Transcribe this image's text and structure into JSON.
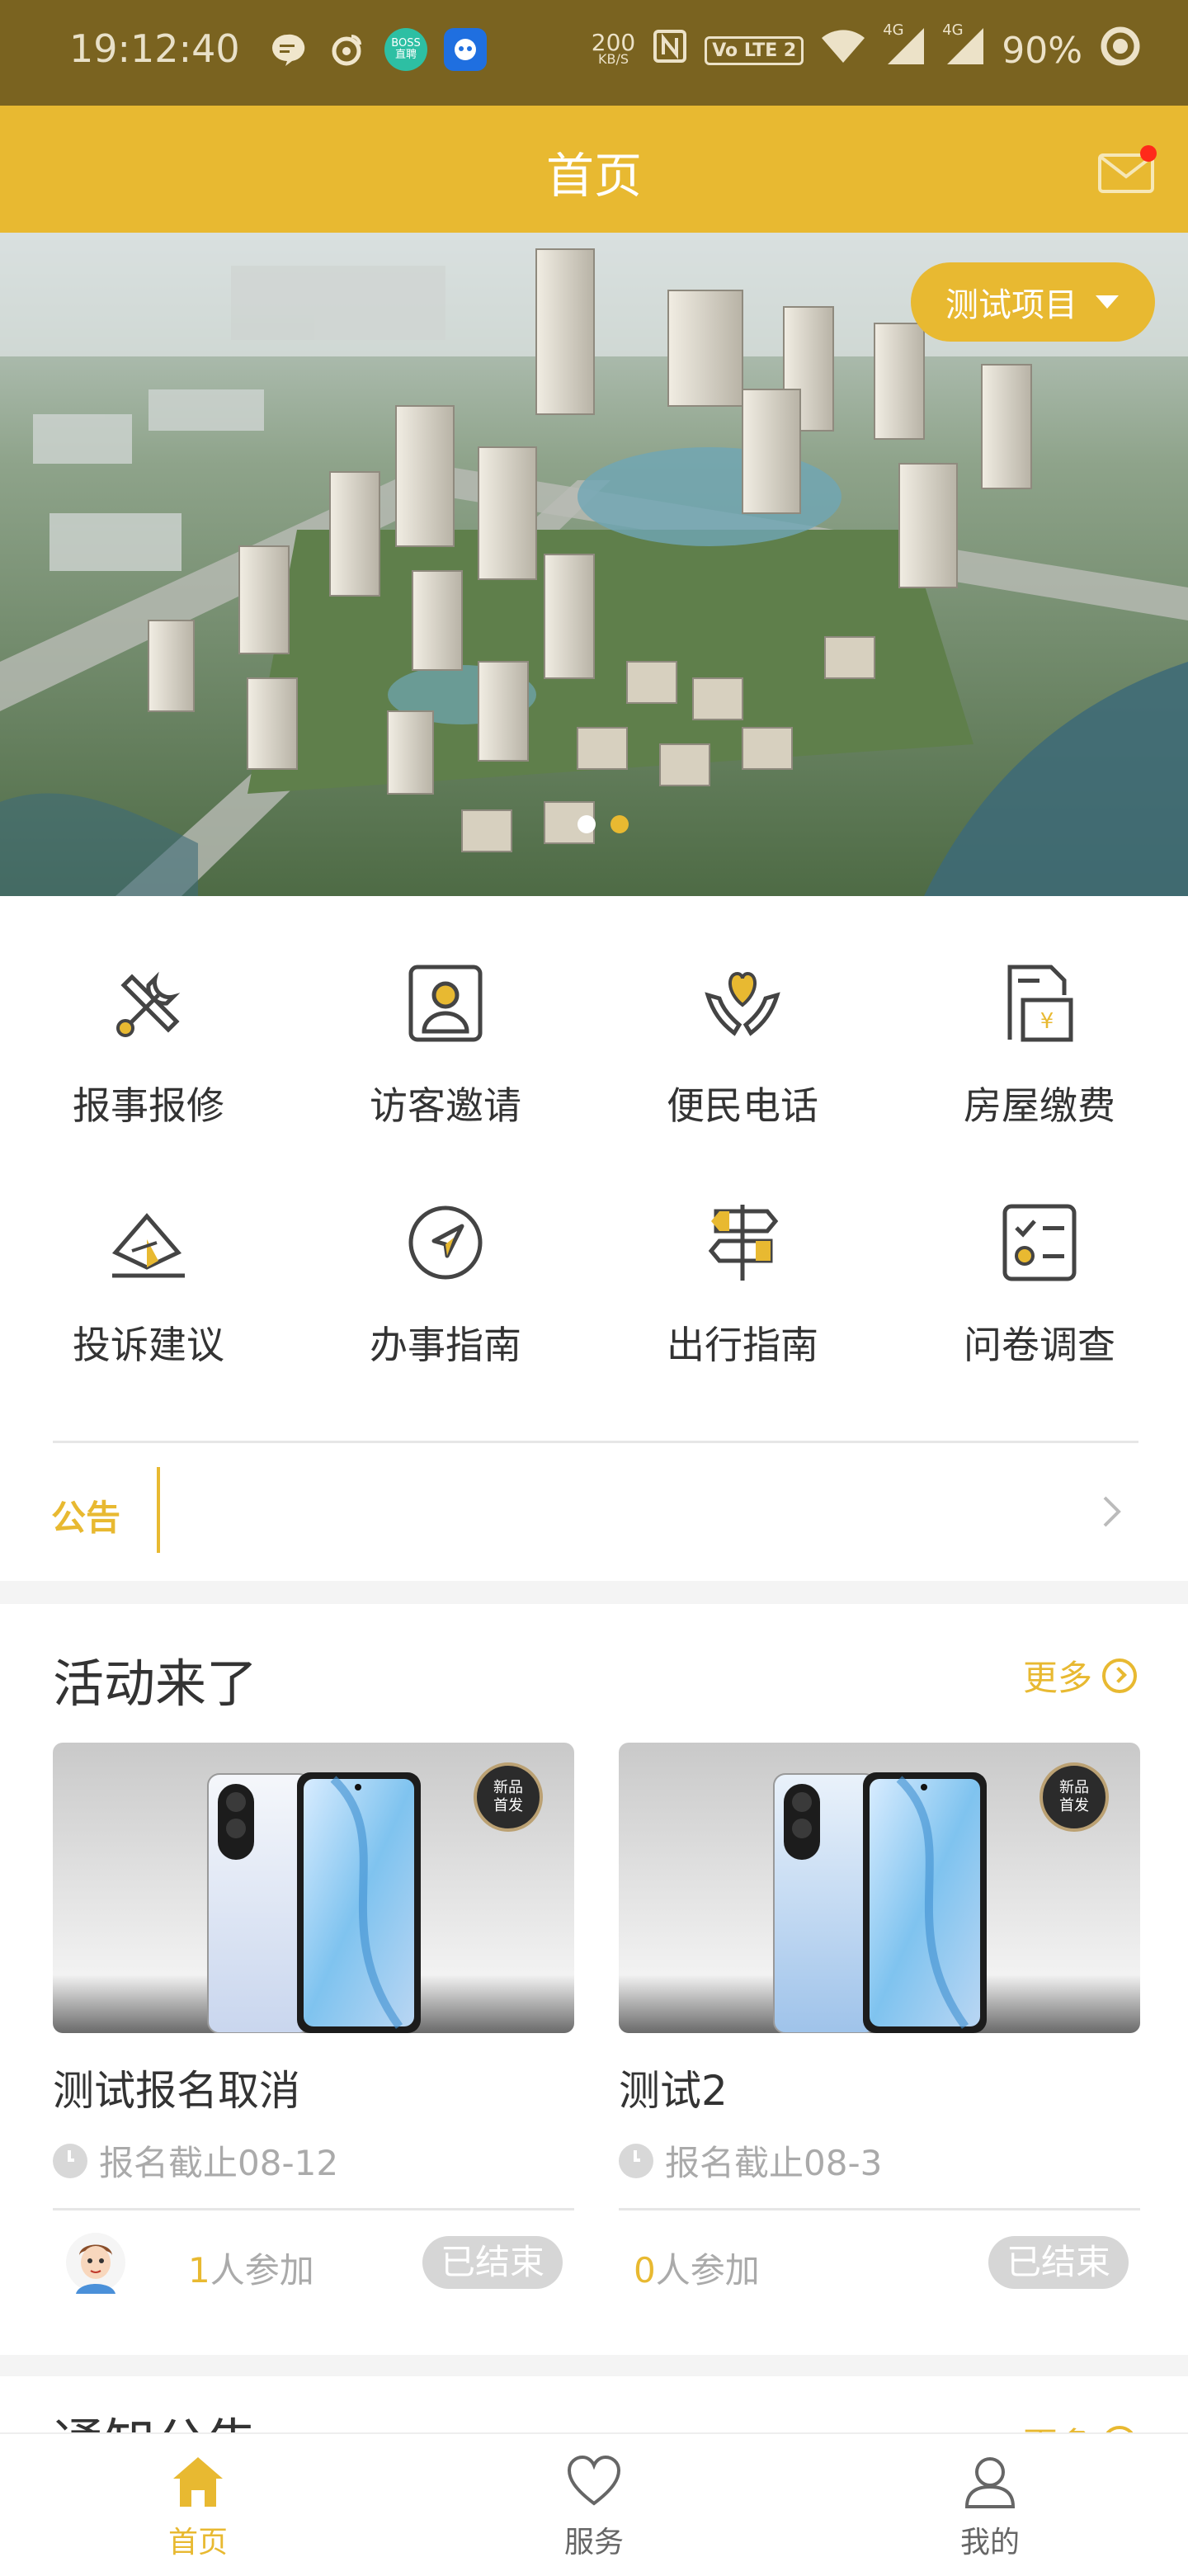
{
  "status_bar": {
    "time": "19:12:40",
    "net_speed_value": "200",
    "net_speed_unit": "KB/S",
    "lte_label": "Vo LTE 2",
    "signal_label_1": "4G",
    "signal_label_2": "4G",
    "battery": "90%",
    "boss_badge": "BOSS 直聘"
  },
  "header": {
    "title": "首页"
  },
  "banner": {
    "project_selector_label": "测试项目",
    "slide_count": 2,
    "active_slide": 2
  },
  "services": [
    {
      "label": "报事报修",
      "icon": "tools-icon"
    },
    {
      "label": "访客邀请",
      "icon": "visitor-card-icon"
    },
    {
      "label": "便民电话",
      "icon": "heart-hands-icon"
    },
    {
      "label": "房屋缴费",
      "icon": "bill-yen-icon"
    },
    {
      "label": "投诉建议",
      "icon": "envelope-edit-icon"
    },
    {
      "label": "办事指南",
      "icon": "compass-arrow-icon"
    },
    {
      "label": "出行指南",
      "icon": "signpost-icon"
    },
    {
      "label": "问卷调查",
      "icon": "checklist-icon"
    }
  ],
  "notice": {
    "tag": "公告",
    "text": ""
  },
  "activities": {
    "title": "活动来了",
    "more_label": "更多",
    "cards": [
      {
        "image_badge": "新品首发",
        "title": "测试报名取消",
        "deadline": "报名截止08-12",
        "participants_num": "1",
        "participants_suffix": "人参加",
        "status": "已结束",
        "has_avatar": true
      },
      {
        "image_badge": "新品首发",
        "title": "测试2",
        "deadline": "报名截止08-3",
        "participants_num": "0",
        "participants_suffix": "人参加",
        "status": "已结束",
        "has_avatar": false
      }
    ]
  },
  "next_section": {
    "title": "通知公告",
    "more_label": "更多"
  },
  "tab_bar": {
    "tabs": [
      {
        "label": "首页",
        "icon": "home-icon",
        "active": true
      },
      {
        "label": "服务",
        "icon": "heart-icon",
        "active": false
      },
      {
        "label": "我的",
        "icon": "user-icon",
        "active": false
      }
    ]
  },
  "colors": {
    "accent": "#e8b931",
    "status_bar": "#7a6320",
    "text_primary": "#333333",
    "text_muted": "#aaaaaa",
    "badge_gray": "#d6d6d6"
  }
}
